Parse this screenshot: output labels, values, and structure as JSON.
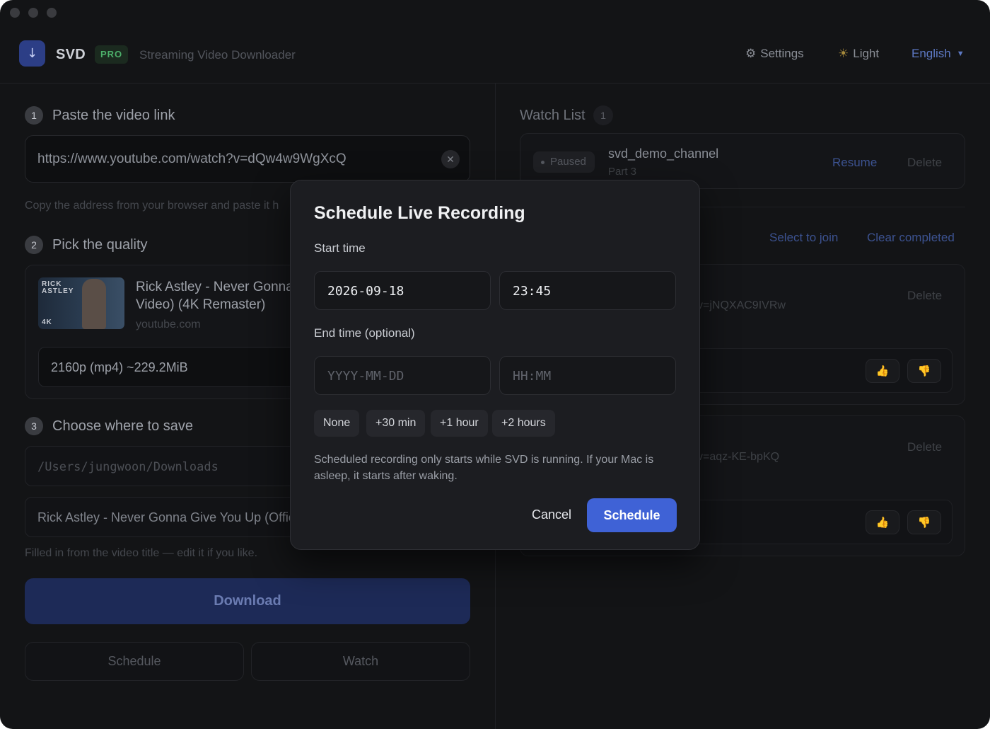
{
  "app": {
    "brand": "SVD",
    "badge": "PRO",
    "subtitle": "Streaming Video Downloader",
    "logo_icon": "download-arrow-icon"
  },
  "header": {
    "settings_label": "Settings",
    "theme_label": "Light",
    "language_label": "English"
  },
  "left": {
    "step1": {
      "num": "1",
      "title": "Paste the video link"
    },
    "url_value": "https://www.youtube.com/watch?v=dQw4w9WgXcQ",
    "url_hint": "Copy the address from your browser and paste it h",
    "step2": {
      "num": "2",
      "title": "Pick the quality"
    },
    "video": {
      "title": "Rick Astley - Never Gonna Video) (4K Remaster)",
      "host": "youtube.com",
      "thumb_text_1": "RICK ASTLEY",
      "thumb_text_2": "4K"
    },
    "quality_value": "2160p (mp4) ~229.2MiB",
    "step3": {
      "num": "3",
      "title": "Choose where to save"
    },
    "path_value": "/Users/jungwoon/Downloads",
    "filename_value": "Rick Astley - Never Gonna Give You Up (Offic",
    "filename_hint": "Filled in from the video title — edit it if you like.",
    "download_label": "Download",
    "schedule_label": "Schedule",
    "watch_label": "Watch"
  },
  "right": {
    "watch_list_title": "Watch List",
    "watch_list_count": "1",
    "watch_item": {
      "status": "Paused",
      "name": "svd_demo_channel",
      "part": "Part 3",
      "resume_label": "Resume",
      "delete_label": "Delete"
    },
    "select_to_join": "Select to join",
    "clear_completed": "Clear completed",
    "queue": [
      {
        "url_fragment": "v=jNQXAC9IVRw",
        "delete_label": "Delete"
      },
      {
        "url_fragment": "v=aqz-KE-bpKQ",
        "delete_label": "Delete"
      }
    ]
  },
  "modal": {
    "title": "Schedule Live Recording",
    "start_label": "Start time",
    "start_date": "2026-09-18",
    "start_time": "23:45",
    "end_label": "End time (optional)",
    "end_date_placeholder": "YYYY-MM-DD",
    "end_time_placeholder": "HH:MM",
    "presets": [
      "None",
      "+30 min",
      "+1 hour",
      "+2 hours"
    ],
    "note": "Scheduled recording only starts while SVD is running. If your Mac is asleep, it starts after waking.",
    "cancel_label": "Cancel",
    "schedule_label": "Schedule"
  }
}
